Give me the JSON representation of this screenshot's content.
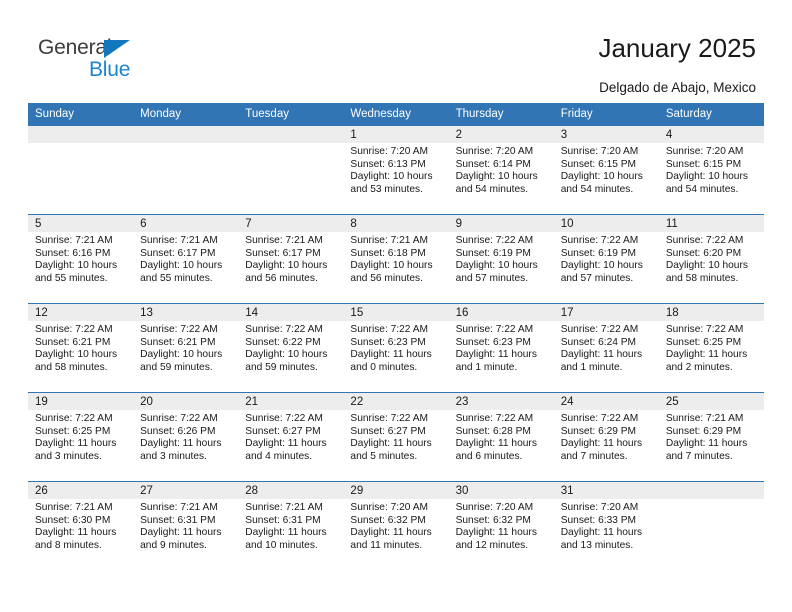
{
  "brand": {
    "name_part1": "General",
    "name_part2": "Blue",
    "triangle_icon": "blue-triangle-icon"
  },
  "header": {
    "title": "January 2025",
    "subtitle": "Delgado de Abajo, Mexico"
  },
  "colors": {
    "header_blue": "#3175b4",
    "daynum_gray": "#ededed",
    "logo_blue": "#1a86d0",
    "logo_dark": "#3d3d3d"
  },
  "calendar": {
    "weekday_headers": [
      "Sunday",
      "Monday",
      "Tuesday",
      "Wednesday",
      "Thursday",
      "Friday",
      "Saturday"
    ],
    "weeks": [
      [
        {
          "day": "",
          "empty": true
        },
        {
          "day": "",
          "empty": true
        },
        {
          "day": "",
          "empty": true
        },
        {
          "day": "1",
          "sunrise": "Sunrise: 7:20 AM",
          "sunset": "Sunset: 6:13 PM",
          "daylight": "Daylight: 10 hours and 53 minutes."
        },
        {
          "day": "2",
          "sunrise": "Sunrise: 7:20 AM",
          "sunset": "Sunset: 6:14 PM",
          "daylight": "Daylight: 10 hours and 54 minutes."
        },
        {
          "day": "3",
          "sunrise": "Sunrise: 7:20 AM",
          "sunset": "Sunset: 6:15 PM",
          "daylight": "Daylight: 10 hours and 54 minutes."
        },
        {
          "day": "4",
          "sunrise": "Sunrise: 7:20 AM",
          "sunset": "Sunset: 6:15 PM",
          "daylight": "Daylight: 10 hours and 54 minutes."
        }
      ],
      [
        {
          "day": "5",
          "sunrise": "Sunrise: 7:21 AM",
          "sunset": "Sunset: 6:16 PM",
          "daylight": "Daylight: 10 hours and 55 minutes."
        },
        {
          "day": "6",
          "sunrise": "Sunrise: 7:21 AM",
          "sunset": "Sunset: 6:17 PM",
          "daylight": "Daylight: 10 hours and 55 minutes."
        },
        {
          "day": "7",
          "sunrise": "Sunrise: 7:21 AM",
          "sunset": "Sunset: 6:17 PM",
          "daylight": "Daylight: 10 hours and 56 minutes."
        },
        {
          "day": "8",
          "sunrise": "Sunrise: 7:21 AM",
          "sunset": "Sunset: 6:18 PM",
          "daylight": "Daylight: 10 hours and 56 minutes."
        },
        {
          "day": "9",
          "sunrise": "Sunrise: 7:22 AM",
          "sunset": "Sunset: 6:19 PM",
          "daylight": "Daylight: 10 hours and 57 minutes."
        },
        {
          "day": "10",
          "sunrise": "Sunrise: 7:22 AM",
          "sunset": "Sunset: 6:19 PM",
          "daylight": "Daylight: 10 hours and 57 minutes."
        },
        {
          "day": "11",
          "sunrise": "Sunrise: 7:22 AM",
          "sunset": "Sunset: 6:20 PM",
          "daylight": "Daylight: 10 hours and 58 minutes."
        }
      ],
      [
        {
          "day": "12",
          "sunrise": "Sunrise: 7:22 AM",
          "sunset": "Sunset: 6:21 PM",
          "daylight": "Daylight: 10 hours and 58 minutes."
        },
        {
          "day": "13",
          "sunrise": "Sunrise: 7:22 AM",
          "sunset": "Sunset: 6:21 PM",
          "daylight": "Daylight: 10 hours and 59 minutes."
        },
        {
          "day": "14",
          "sunrise": "Sunrise: 7:22 AM",
          "sunset": "Sunset: 6:22 PM",
          "daylight": "Daylight: 10 hours and 59 minutes."
        },
        {
          "day": "15",
          "sunrise": "Sunrise: 7:22 AM",
          "sunset": "Sunset: 6:23 PM",
          "daylight": "Daylight: 11 hours and 0 minutes."
        },
        {
          "day": "16",
          "sunrise": "Sunrise: 7:22 AM",
          "sunset": "Sunset: 6:23 PM",
          "daylight": "Daylight: 11 hours and 1 minute."
        },
        {
          "day": "17",
          "sunrise": "Sunrise: 7:22 AM",
          "sunset": "Sunset: 6:24 PM",
          "daylight": "Daylight: 11 hours and 1 minute."
        },
        {
          "day": "18",
          "sunrise": "Sunrise: 7:22 AM",
          "sunset": "Sunset: 6:25 PM",
          "daylight": "Daylight: 11 hours and 2 minutes."
        }
      ],
      [
        {
          "day": "19",
          "sunrise": "Sunrise: 7:22 AM",
          "sunset": "Sunset: 6:25 PM",
          "daylight": "Daylight: 11 hours and 3 minutes."
        },
        {
          "day": "20",
          "sunrise": "Sunrise: 7:22 AM",
          "sunset": "Sunset: 6:26 PM",
          "daylight": "Daylight: 11 hours and 3 minutes."
        },
        {
          "day": "21",
          "sunrise": "Sunrise: 7:22 AM",
          "sunset": "Sunset: 6:27 PM",
          "daylight": "Daylight: 11 hours and 4 minutes."
        },
        {
          "day": "22",
          "sunrise": "Sunrise: 7:22 AM",
          "sunset": "Sunset: 6:27 PM",
          "daylight": "Daylight: 11 hours and 5 minutes."
        },
        {
          "day": "23",
          "sunrise": "Sunrise: 7:22 AM",
          "sunset": "Sunset: 6:28 PM",
          "daylight": "Daylight: 11 hours and 6 minutes."
        },
        {
          "day": "24",
          "sunrise": "Sunrise: 7:22 AM",
          "sunset": "Sunset: 6:29 PM",
          "daylight": "Daylight: 11 hours and 7 minutes."
        },
        {
          "day": "25",
          "sunrise": "Sunrise: 7:21 AM",
          "sunset": "Sunset: 6:29 PM",
          "daylight": "Daylight: 11 hours and 7 minutes."
        }
      ],
      [
        {
          "day": "26",
          "sunrise": "Sunrise: 7:21 AM",
          "sunset": "Sunset: 6:30 PM",
          "daylight": "Daylight: 11 hours and 8 minutes."
        },
        {
          "day": "27",
          "sunrise": "Sunrise: 7:21 AM",
          "sunset": "Sunset: 6:31 PM",
          "daylight": "Daylight: 11 hours and 9 minutes."
        },
        {
          "day": "28",
          "sunrise": "Sunrise: 7:21 AM",
          "sunset": "Sunset: 6:31 PM",
          "daylight": "Daylight: 11 hours and 10 minutes."
        },
        {
          "day": "29",
          "sunrise": "Sunrise: 7:20 AM",
          "sunset": "Sunset: 6:32 PM",
          "daylight": "Daylight: 11 hours and 11 minutes."
        },
        {
          "day": "30",
          "sunrise": "Sunrise: 7:20 AM",
          "sunset": "Sunset: 6:32 PM",
          "daylight": "Daylight: 11 hours and 12 minutes."
        },
        {
          "day": "31",
          "sunrise": "Sunrise: 7:20 AM",
          "sunset": "Sunset: 6:33 PM",
          "daylight": "Daylight: 11 hours and 13 minutes."
        },
        {
          "day": "",
          "empty": true
        }
      ]
    ]
  }
}
